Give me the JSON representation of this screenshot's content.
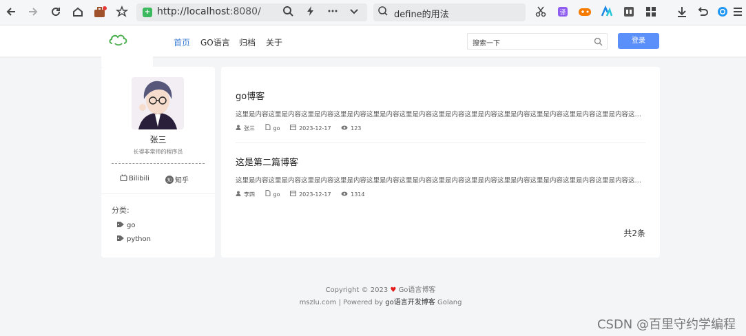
{
  "browser": {
    "url_host": "http://localhost",
    "url_port": ":8080/",
    "search_query": "define的用法",
    "icons": [
      "back-icon",
      "forward-icon",
      "reload-icon",
      "home-icon",
      "briefcase-icon",
      "star-icon",
      "zoom-icon",
      "lightning-icon",
      "more-icon",
      "chevron-down-icon",
      "scissors-icon",
      "translate-icon",
      "game-icon",
      "app-icon",
      "reader-icon",
      "grid-icon",
      "download-icon",
      "undo-icon",
      "browser-icon",
      "menu-icon"
    ]
  },
  "nav": {
    "items": [
      "首页",
      "GO语言",
      "归档",
      "关于"
    ],
    "active_color": "#3d7fd6",
    "search_placeholder": "搜索一下",
    "login_label": "登录",
    "login_color": "#5b8ff9"
  },
  "profile": {
    "name": "张三",
    "desc": "长得非常帅的程序员",
    "links": [
      "Bilibili",
      "知乎"
    ],
    "category_label": "分类:",
    "categories": [
      "go",
      "python"
    ]
  },
  "posts": [
    {
      "title": "go博客",
      "summary": "这里是内容这里是内容这里是内容这里是内容这里是内容这里是内容这里是内容这里是内容这里是内容这里是内容这里是内容这里是内容这里是内容这里是内容这里是内容",
      "author": "张三",
      "category": "go",
      "date": "2023-12-17",
      "views": "123"
    },
    {
      "title": "这是第二篇博客",
      "summary": "这里是内容这里是内容这里是内容这里是内容这里是内容这里是内容这里是内容这里是内容这里是内容这里是内容这里是内容这里是内容这里是内容这里是内容这里是内容",
      "author": "李四",
      "category": "go",
      "date": "2023-12-17",
      "views": "1314"
    }
  ],
  "total": "共2条",
  "footer": {
    "copyright": "Copyright © 2023",
    "heart": "♥",
    "blog_name": "Go语言博客",
    "line2_prefix": "mszlu.com | Powered by",
    "line2_dark": "go语言开发博客",
    "line2_suffix": "Golang"
  },
  "watermark": "CSDN @百里守约学编程"
}
